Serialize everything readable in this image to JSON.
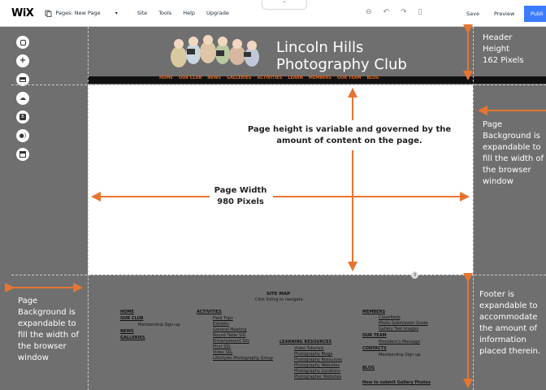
{
  "toolbar": {
    "logo": "WiX",
    "pages_label": "Pages: New Page",
    "menu": [
      "Site",
      "Tools",
      "Help",
      "Upgrade"
    ],
    "save": "Save",
    "preview": "Preview",
    "publish": "Publi"
  },
  "rail_icons": [
    "add-icon",
    "plus-icon",
    "menu-icon",
    "upload-icon",
    "blog-icon",
    "chat-icon",
    "calendar-icon"
  ],
  "site_header": {
    "title_line1": "Lincoln Hills",
    "title_line2": "Photography Club",
    "nav": [
      "HOME",
      "OUR CLUB",
      "NEWS",
      "GALLERIES",
      "ACTIVITIES",
      "LEARN",
      "MEMBERS",
      "OUR TEAM",
      "BLOG"
    ]
  },
  "annotations": {
    "header_height": [
      "Header",
      "Height",
      "162 Pixels"
    ],
    "page_height": [
      "Page height is variable and governed by the",
      "amount of content on the page."
    ],
    "page_width": [
      "Page Width",
      "980 Pixels"
    ],
    "page_bg_right": [
      "Page",
      "Background is",
      "expandable to",
      "fill the width of",
      "the browser",
      "window"
    ],
    "page_bg_left": [
      "Page",
      "Background is",
      "expandable to",
      "fill the width of",
      "the browser",
      "window"
    ],
    "footer": [
      "Footer is",
      "expandable to",
      "accommodate",
      "the amount of",
      "information",
      "placed therein."
    ]
  },
  "footer": {
    "site_map_title": "SITE MAP",
    "site_map_sub": "Click listing to navigate.",
    "col1": {
      "home": "HOME",
      "our_club": "OUR CLUB",
      "membership": "Membership Sign-up",
      "news": "NEWS",
      "galleries": "GALLERIES"
    },
    "col2": {
      "activities": "ACTIVITIES",
      "items": [
        "Field Trips",
        "Exhibits",
        "General Meeting",
        "Round Table SIG",
        "Enhancement SIG",
        "Print SIG",
        "Video SIG",
        "Lifestyles Photography Group"
      ]
    },
    "col3": {
      "learning": "LEARNING RESOURCES",
      "items": [
        "Video Tutorials",
        "Photography Blogs",
        "Photography Resources",
        "Photography Websites",
        "Photography Locations",
        "Photographer Websites"
      ]
    },
    "col4": {
      "members": "MEMBERS",
      "members_items": [
        "Classifieds",
        "Photo Submission Guide",
        "Gallery Test Images"
      ],
      "our_team": "OUR TEAM",
      "presidents": "President's Message",
      "contacts": "CONTACTS",
      "membership": "Membership Sign-up",
      "blog": "BLOG",
      "how_to": "How to submit Gallery Photos"
    }
  },
  "colors": {
    "arrow": "#e8752f",
    "nav": "#e06a28",
    "publish": "#3b7cff"
  }
}
